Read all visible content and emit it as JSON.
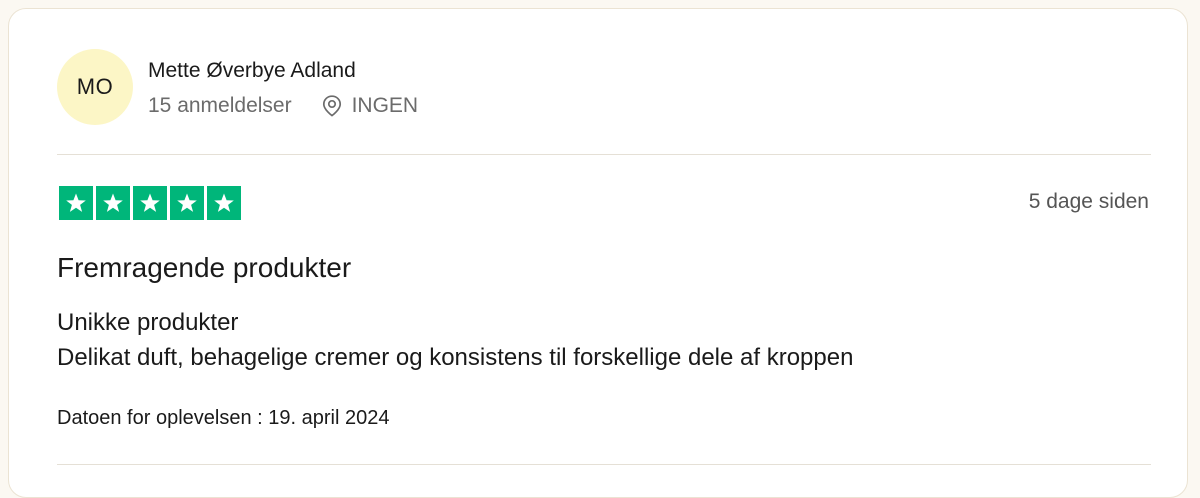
{
  "review": {
    "avatar_initials": "MO",
    "avatar_color": "#fcf6c6",
    "consumer_name": "Mette Øverbye Adland",
    "reviews_count": "15 anmeldelser",
    "location_icon": "map-pin-icon",
    "location": "INGEN",
    "rating": 5,
    "rating_max": 5,
    "star_color": "#00b67a",
    "date_ago": "5 dage siden",
    "title": "Fremragende produkter",
    "body_line1": "Unikke produkter",
    "body_line2": "Delikat duft, behagelige cremer og konsistens til forskellige dele af kroppen",
    "experience_date": "Datoen for oplevelsen : 19. april 2024"
  }
}
